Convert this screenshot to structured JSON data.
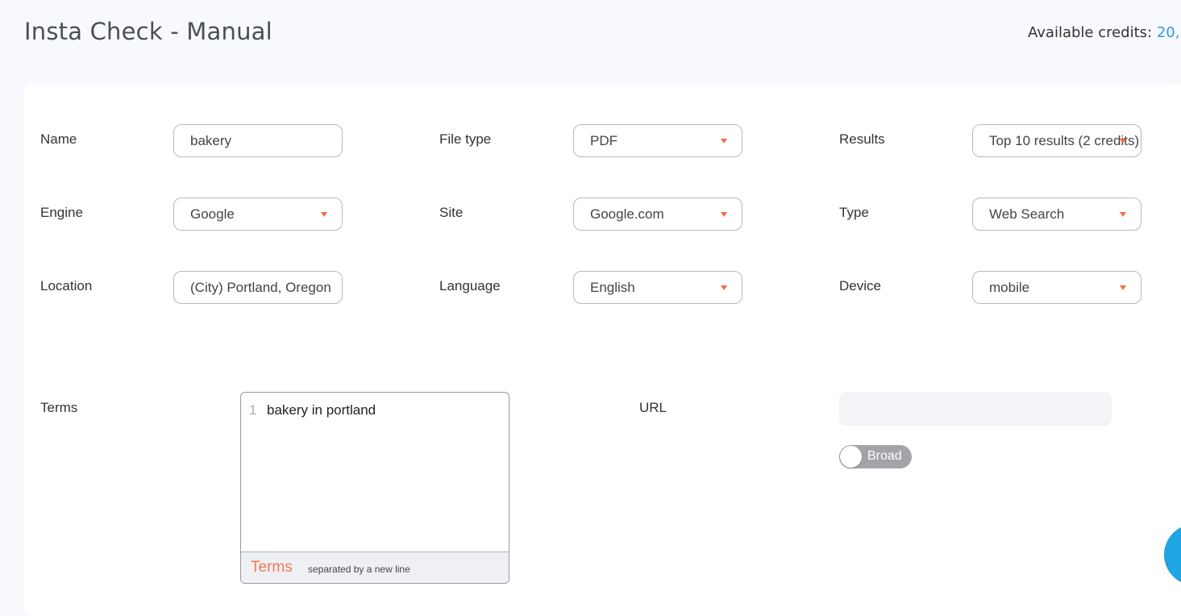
{
  "header": {
    "title": "Insta Check - Manual",
    "credits_label": "Available credits:",
    "credits_value": "20,"
  },
  "form": {
    "name": {
      "label": "Name",
      "value": "bakery"
    },
    "file_type": {
      "label": "File type",
      "value": "PDF"
    },
    "results": {
      "label": "Results",
      "value": "Top 10 results (2 credits)"
    },
    "engine": {
      "label": "Engine",
      "value": "Google"
    },
    "site": {
      "label": "Site",
      "value": "Google.com"
    },
    "type": {
      "label": "Type",
      "value": "Web Search"
    },
    "location": {
      "label": "Location",
      "value": "(City) Portland, Oregon"
    },
    "language": {
      "label": "Language",
      "value": "English"
    },
    "device": {
      "label": "Device",
      "value": "mobile"
    }
  },
  "terms": {
    "label": "Terms",
    "lines": [
      {
        "num": "1",
        "text": "bakery in portland"
      }
    ],
    "footer_tag": "Terms",
    "footer_hint": "separated by a new line"
  },
  "url": {
    "label": "URL",
    "value": "",
    "toggle_label": "Broad"
  },
  "colors": {
    "accent": "#f36a43",
    "link": "#2d9de0",
    "chat": "#1fa4e4"
  },
  "icons": {
    "select_arrow": "caret-down-icon",
    "chat": "chat-bubble-icon"
  }
}
